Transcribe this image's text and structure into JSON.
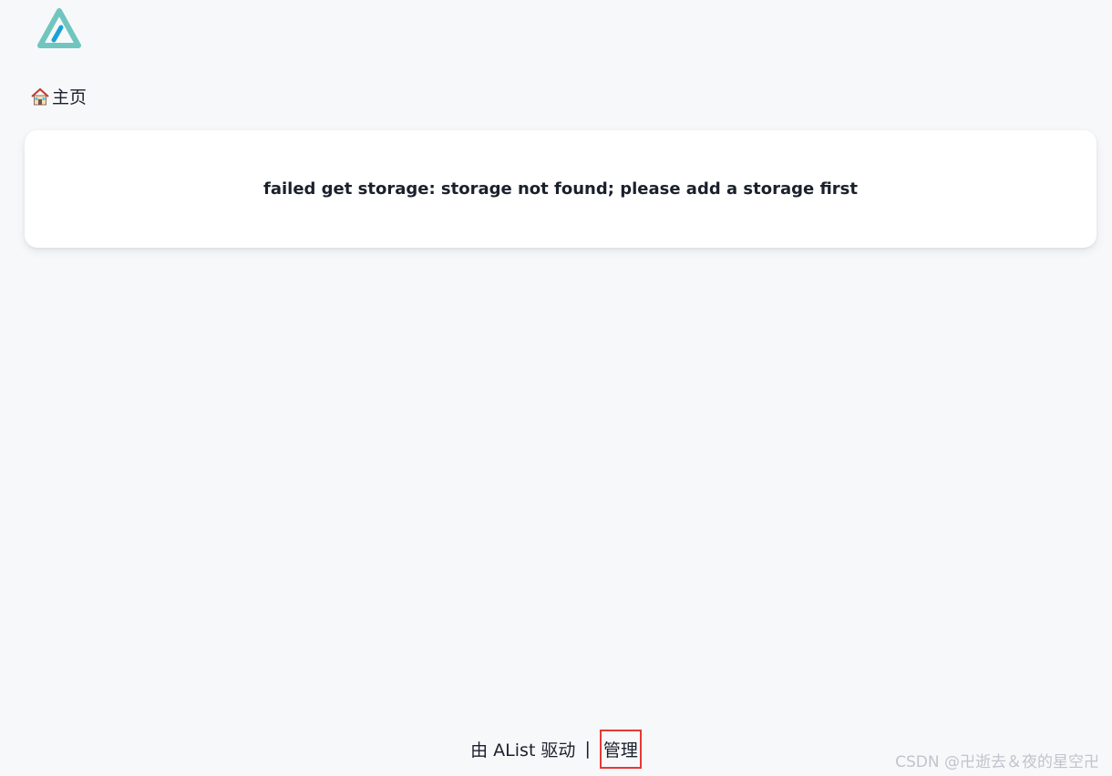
{
  "header": {
    "logo_icon": "alist-logo-icon",
    "logo_colors": {
      "primary": "#70c6be",
      "secondary": "#1ba0d8"
    }
  },
  "breadcrumb": {
    "home_icon": "house-icon",
    "home_label": "主页"
  },
  "main": {
    "error_message": "failed get storage: storage not found; please add a storage first"
  },
  "footer": {
    "powered_by": "由 AList 驱动",
    "separator": "|",
    "manage_label": "管理",
    "highlight_color": "#e53935"
  },
  "watermark": {
    "text": "CSDN @卍逝去＆夜的星空卍"
  }
}
